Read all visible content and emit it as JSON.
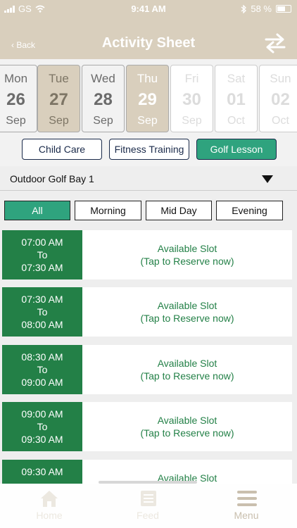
{
  "status": {
    "carrier": "GS",
    "time": "9:41 AM",
    "battery": "58 %"
  },
  "nav": {
    "back": "Back",
    "title": "Activity Sheet"
  },
  "days": [
    {
      "name": "Mon",
      "date": "26",
      "month": "Sep",
      "state": "past"
    },
    {
      "name": "Tue",
      "date": "27",
      "month": "Sep",
      "state": "selected"
    },
    {
      "name": "Wed",
      "date": "28",
      "month": "Sep",
      "state": "past"
    },
    {
      "name": "Thu",
      "date": "29",
      "month": "Sep",
      "state": "today"
    },
    {
      "name": "Fri",
      "date": "30",
      "month": "Sep",
      "state": "future"
    },
    {
      "name": "Sat",
      "date": "01",
      "month": "Oct",
      "state": "future"
    },
    {
      "name": "Sun",
      "date": "02",
      "month": "Oct",
      "state": "future"
    }
  ],
  "categories": [
    {
      "label": "Child Care",
      "active": false
    },
    {
      "label": "Fitness Training",
      "active": false
    },
    {
      "label": "Golf Lesson",
      "active": true
    }
  ],
  "location": {
    "selected": "Outdoor Golf Bay 1"
  },
  "filters": [
    {
      "label": "All",
      "active": true
    },
    {
      "label": "Morning",
      "active": false
    },
    {
      "label": "Mid Day",
      "active": false
    },
    {
      "label": "Evening",
      "active": false
    }
  ],
  "slots": [
    {
      "start": "07:00 AM",
      "to": "To",
      "end": "07:30 AM",
      "status": "Available Slot",
      "action": "(Tap to Reserve now)"
    },
    {
      "start": "07:30 AM",
      "to": "To",
      "end": "08:00 AM",
      "status": "Available Slot",
      "action": "(Tap to Reserve now)"
    },
    {
      "start": "08:30 AM",
      "to": "To",
      "end": "09:00 AM",
      "status": "Available Slot",
      "action": "(Tap to Reserve now)"
    },
    {
      "start": "09:00 AM",
      "to": "To",
      "end": "09:30 AM",
      "status": "Available Slot",
      "action": "(Tap to Reserve now)"
    },
    {
      "start": "09:30 AM",
      "to": "",
      "end": "",
      "status": "Available Slot",
      "action": ""
    }
  ],
  "tabs": [
    {
      "label": "Home",
      "icon": "home-icon"
    },
    {
      "label": "Feed",
      "icon": "feed-icon"
    },
    {
      "label": "Menu",
      "icon": "menu-icon"
    }
  ],
  "colors": {
    "header": "#d9cfbd",
    "accent": "#2fa37e",
    "slot_time": "#238047"
  }
}
